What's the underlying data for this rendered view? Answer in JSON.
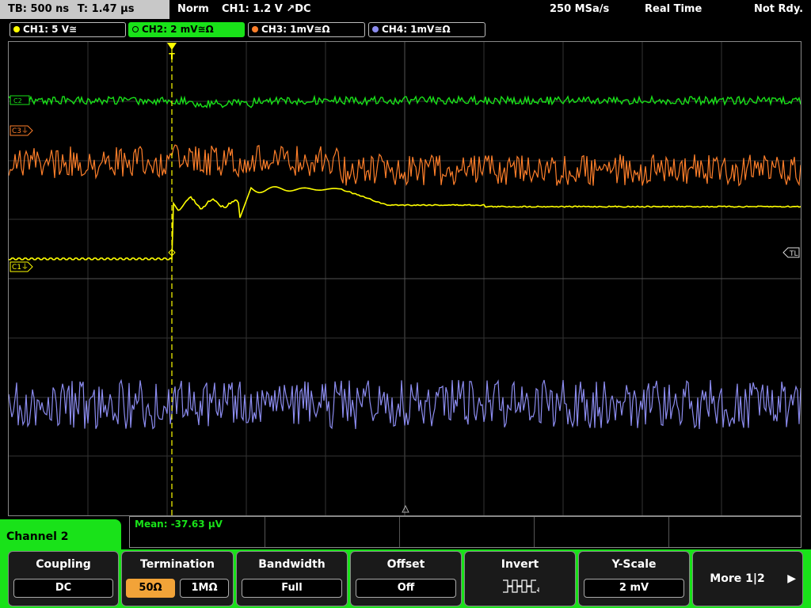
{
  "status": {
    "timebase": "TB: 500 ns",
    "trigger_time": "T: 1.47 µs",
    "trigger_mode": "Norm",
    "trigger_source": "CH1: 1.2 V ↗DC",
    "sample_rate": "250 MSa/s",
    "acq_mode": "Real Time",
    "ready_state": "Not Rdy."
  },
  "channels": [
    {
      "label": "CH1: 5 V≅",
      "color": "#ffff00"
    },
    {
      "label": "CH2: 2 mV≅Ω",
      "color": "#19e219"
    },
    {
      "label": "CH3: 1mV≅Ω",
      "color": "#ff7f2a"
    },
    {
      "label": "CH4: 1mV≅Ω",
      "color": "#8c8cf0"
    }
  ],
  "markers": {
    "c2": "C2",
    "c3": "C3⏚",
    "c1": "C1⏚",
    "trigger_level": "TL",
    "trigger_pos": "T"
  },
  "measurement": {
    "mean": "Mean: -37.63 µV"
  },
  "menu_title": "Channel 2",
  "softkeys": {
    "coupling": {
      "label": "Coupling",
      "value": "DC"
    },
    "termination": {
      "label": "Termination",
      "value_a": "50Ω",
      "value_b": "1MΩ"
    },
    "bandwidth": {
      "label": "Bandwidth",
      "value": "Full"
    },
    "offset": {
      "label": "Offset",
      "value": "Off"
    },
    "invert": {
      "label": "Invert",
      "icon": "invert-waveform-icon"
    },
    "yscale": {
      "label": "Y-Scale",
      "value": "2 mV"
    },
    "more": {
      "label": "More 1|2"
    }
  }
}
